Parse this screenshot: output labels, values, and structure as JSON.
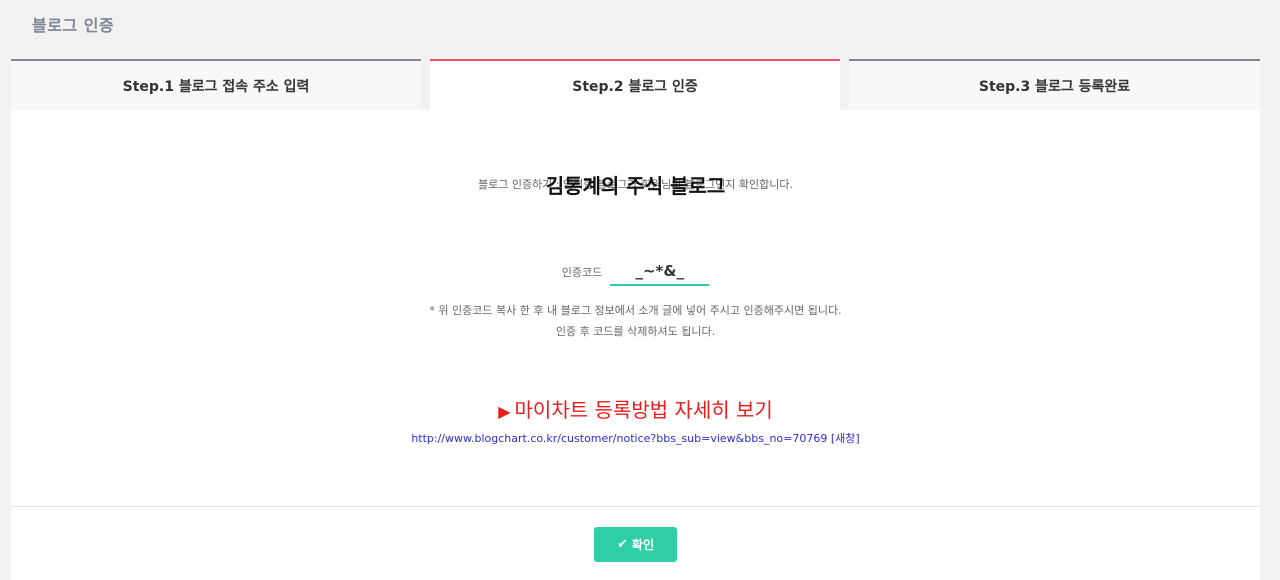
{
  "page": {
    "title": "블로그 인증"
  },
  "tabs": [
    {
      "label": "Step.1 블로그 접속 주소 입력",
      "active": false
    },
    {
      "label": "Step.2 블로그 인증",
      "active": true
    },
    {
      "label": "Step.3 블로그 등록완료",
      "active": false
    }
  ],
  "auth": {
    "blog_name": "김통계의 주식 블로그",
    "description": "블로그 인증하기 : 입력한 블로그가 회원님의 블로그인지 확인합니다.",
    "code_label": "인증코드",
    "code_value": "_~*&_",
    "note_line1": "* 위 인증코드 복사 한 후 내 블로그 정보에서 소개 글에 넣어 주시고 인증해주시면 됩니다.",
    "note_line2": "인증 후 코드를 삭제하셔도 됩니다."
  },
  "guide": {
    "arrow": "▶",
    "label": "마이차트 등록방법 자세히 보기",
    "url": "http://www.blogchart.co.kr/customer/notice?bbs_sub=view&bbs_no=70769 [새창]"
  },
  "footer": {
    "check_icon": "✔",
    "confirm_label": "확인"
  },
  "colors": {
    "accent_active": "#ee4f63",
    "accent_button": "#2ecfa5",
    "link_red": "#e81c1c",
    "link_blue": "#2d2dd2"
  }
}
